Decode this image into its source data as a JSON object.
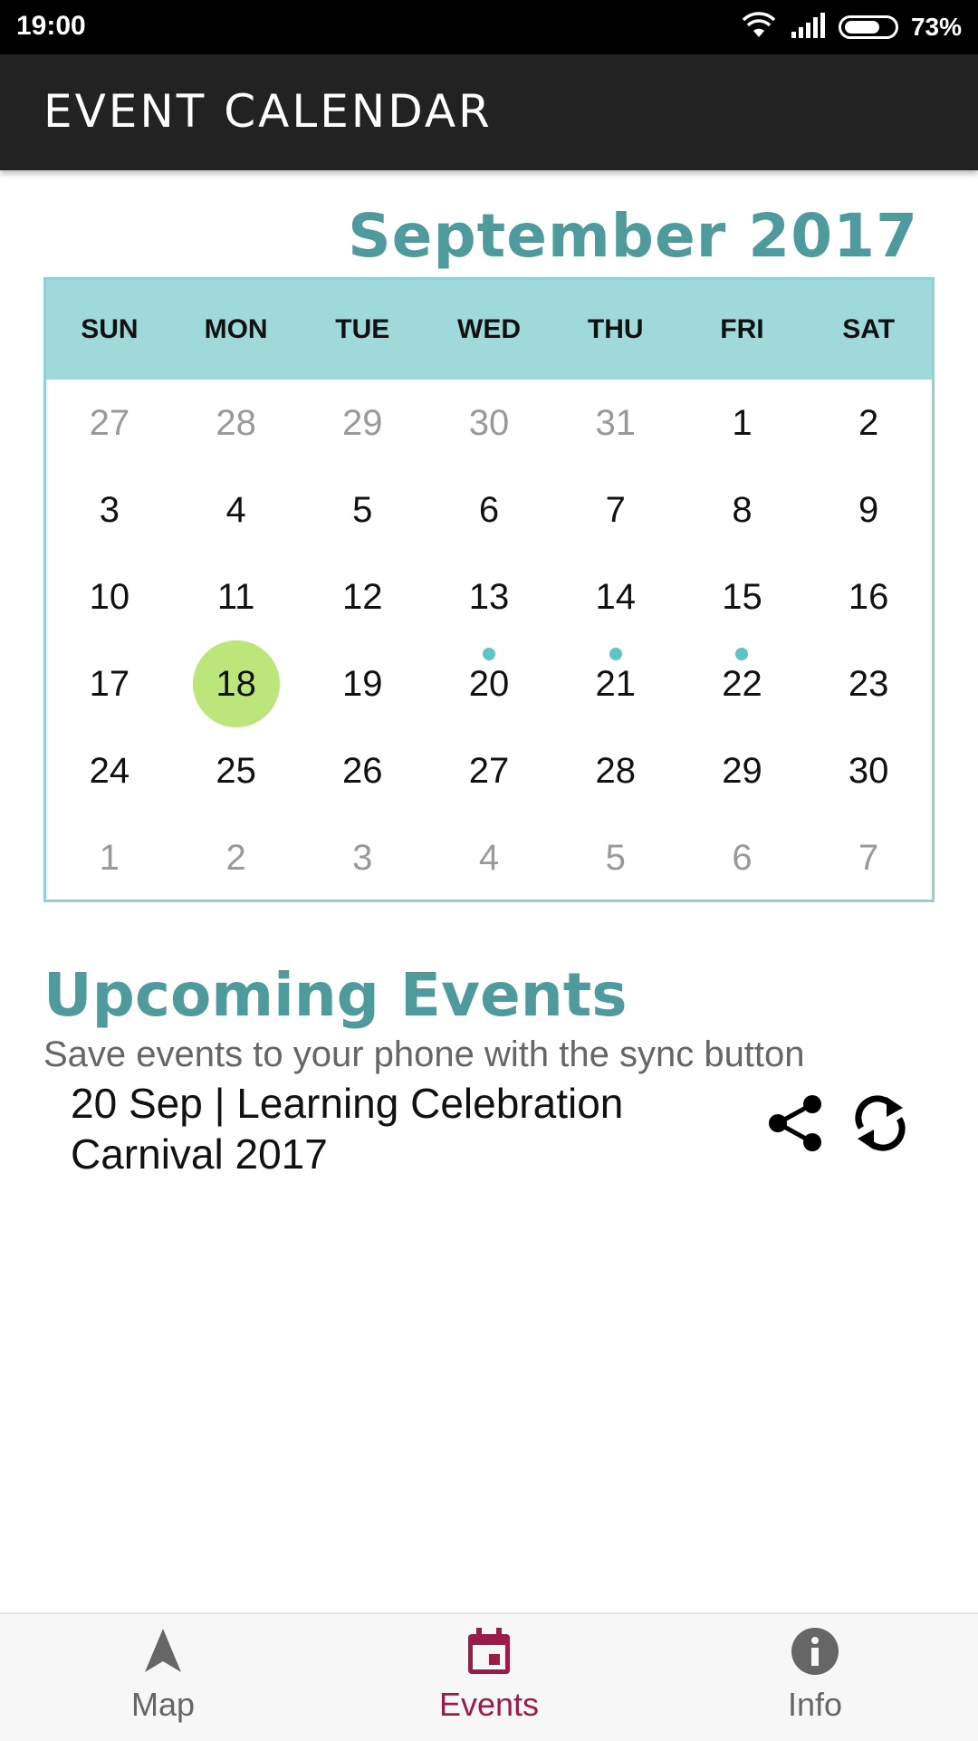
{
  "status_bar": {
    "time": "19:00",
    "battery_percent": "73%",
    "battery_level": 0.73
  },
  "app_bar": {
    "title": "EVENT CALENDAR"
  },
  "calendar": {
    "month_title": "September 2017",
    "weekdays": [
      "SUN",
      "MON",
      "TUE",
      "WED",
      "THU",
      "FRI",
      "SAT"
    ],
    "weeks": [
      [
        {
          "d": "27",
          "muted": true
        },
        {
          "d": "28",
          "muted": true
        },
        {
          "d": "29",
          "muted": true
        },
        {
          "d": "30",
          "muted": true
        },
        {
          "d": "31",
          "muted": true
        },
        {
          "d": "1"
        },
        {
          "d": "2"
        }
      ],
      [
        {
          "d": "3"
        },
        {
          "d": "4"
        },
        {
          "d": "5"
        },
        {
          "d": "6"
        },
        {
          "d": "7"
        },
        {
          "d": "8"
        },
        {
          "d": "9"
        }
      ],
      [
        {
          "d": "10"
        },
        {
          "d": "11"
        },
        {
          "d": "12"
        },
        {
          "d": "13"
        },
        {
          "d": "14"
        },
        {
          "d": "15"
        },
        {
          "d": "16"
        }
      ],
      [
        {
          "d": "17"
        },
        {
          "d": "18",
          "today": true
        },
        {
          "d": "19"
        },
        {
          "d": "20",
          "event": true
        },
        {
          "d": "21",
          "event": true
        },
        {
          "d": "22",
          "event": true
        },
        {
          "d": "23"
        }
      ],
      [
        {
          "d": "24"
        },
        {
          "d": "25"
        },
        {
          "d": "26"
        },
        {
          "d": "27"
        },
        {
          "d": "28"
        },
        {
          "d": "29"
        },
        {
          "d": "30"
        }
      ],
      [
        {
          "d": "1",
          "muted": true
        },
        {
          "d": "2",
          "muted": true
        },
        {
          "d": "3",
          "muted": true
        },
        {
          "d": "4",
          "muted": true
        },
        {
          "d": "5",
          "muted": true
        },
        {
          "d": "6",
          "muted": true
        },
        {
          "d": "7",
          "muted": true
        }
      ]
    ],
    "colors": {
      "header_bg": "#9fd9d9",
      "border": "#8fd2d2",
      "today": "#bde67a",
      "event_dot": "#5ec4c4"
    }
  },
  "upcoming": {
    "title": "Upcoming Events",
    "subtitle": "Save events to your phone with the sync button",
    "events": [
      {
        "text": "20 Sep | Learning Celebration Carnival 2017",
        "share_icon": "share-icon",
        "sync_icon": "sync-icon"
      }
    ]
  },
  "bottom_nav": {
    "items": [
      {
        "label": "Map",
        "icon": "navigation-arrow-icon",
        "active": false
      },
      {
        "label": "Events",
        "icon": "calendar-icon",
        "active": true
      },
      {
        "label": "Info",
        "icon": "info-icon",
        "active": false
      }
    ],
    "active_color": "#9b1b4a"
  }
}
